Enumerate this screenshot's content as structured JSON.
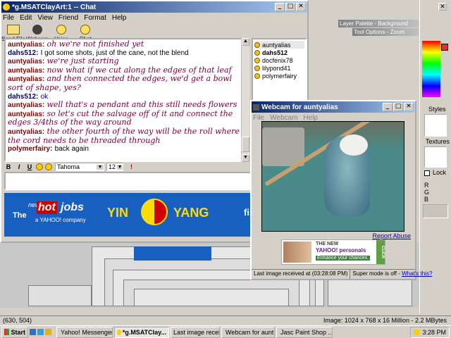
{
  "chat_window": {
    "title": "*g.MSATClayArt:1 -- Chat",
    "menu": [
      "File",
      "Edit",
      "View",
      "Friend",
      "Format",
      "Help"
    ],
    "tools": [
      "Send File",
      "Webcam",
      "Voice",
      "Chat"
    ],
    "messages": [
      {
        "nick": "auntyalias:",
        "text": "oh we're not finished yet",
        "style": "cursive"
      },
      {
        "nick": "dahs512:",
        "text": "I got some shots, just of the cane, not the blend",
        "style": "plain"
      },
      {
        "nick": "auntyalias:",
        "text": "we're just starting",
        "style": "cursive"
      },
      {
        "nick": "auntyalias:",
        "text": "now what if we cut along the edges of that leaf",
        "style": "cursive"
      },
      {
        "nick": "auntyalias:",
        "text": "and then connected the edges, we'd get a bowl sort of shape, yes?",
        "style": "cursive"
      },
      {
        "nick": "dahs512:",
        "text": "ok",
        "style": "plainblue"
      },
      {
        "nick": "auntyalias:",
        "text": "well that's a pendant and this still needs flowers",
        "style": "cursive"
      },
      {
        "nick": "auntyalias:",
        "text": "so let's cut the salvage off of it and connect the edges 3/4ths of the way around",
        "style": "cursive"
      },
      {
        "nick": "auntyalias:",
        "text": "the other fourth of the way will be the roll where the cord needs to be threaded through",
        "style": "cursive"
      },
      {
        "nick": "polymerfairy:",
        "text": "back again",
        "style": "plain"
      }
    ],
    "friends": [
      "auntyalias",
      "dahs512",
      "docfenix78",
      "lilypond41",
      "polymerfairy"
    ],
    "format": {
      "font": "Tahoma",
      "size": "12",
      "bold": "B",
      "italic": "I",
      "underline": "U"
    },
    "ad": {
      "the": "The",
      "new": "new",
      "hot": "hot",
      "jobs": "jobs",
      "company": "a YAHOO! company",
      "yin": "YIN",
      "yang": "YANG",
      "fi": "fi"
    }
  },
  "webcam_window": {
    "title": "Webcam for auntyalias",
    "menu": [
      "File",
      "Webcam",
      "Help"
    ],
    "report_abuse": "Report Abuse",
    "ad": {
      "line1": "THE NEW",
      "line2": "YAHOO! personals",
      "line3": "Enhance your chances.",
      "click": "CLICK"
    },
    "last_image": "Last image received at (03:28:08 PM)",
    "super_mode": "Super mode is off - ",
    "whats_this": "What's this?"
  },
  "paint_shop": {
    "layer_palette": "Layer Palette - Background",
    "tool_options": "Tool Options - Zoom",
    "styles": "Styles",
    "textures": "Textures",
    "lock": "Lock",
    "r": "R",
    "g": "G",
    "b": "B",
    "coords": "(630, 504)",
    "image_info": "Image:  1024 x 768 x 16 Million - 2.2 MBytes"
  },
  "taskbar": {
    "start": "Start",
    "tasks": [
      "Yahoo! Messenger",
      "*g.MSATClay...",
      "Last image received...",
      "Webcam for aunt...",
      "Jasc Paint Shop ..."
    ],
    "time": "3:28 PM"
  },
  "colors": {
    "title_active": "#0a246a",
    "chat_text": "#800040",
    "ad_blue": "#1860c0"
  }
}
